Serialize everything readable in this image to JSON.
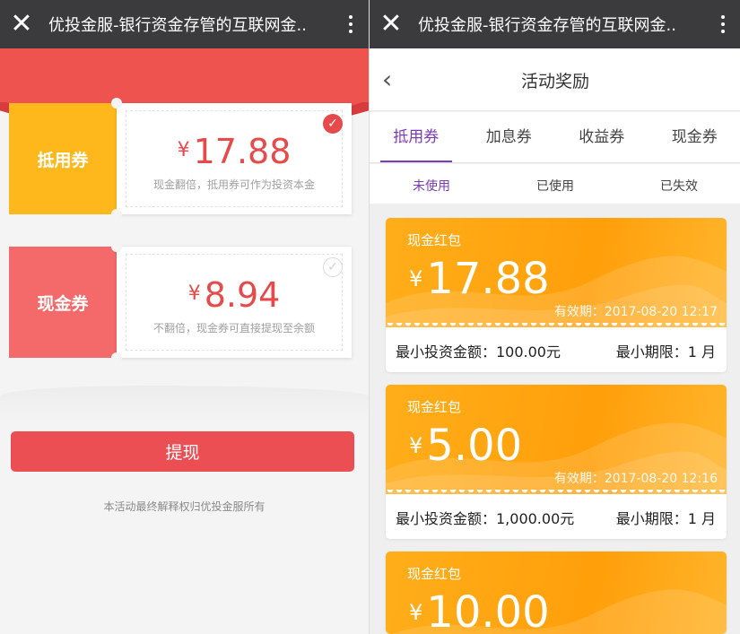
{
  "left": {
    "topbar": {
      "close": "✕",
      "title": "优投金服-银行资金存管的互联网金.."
    },
    "tickets": [
      {
        "type": "抵用券",
        "currency": "¥",
        "amount": "17.88",
        "desc": "现金翻倍，抵用券可作为投资本金",
        "checked": true,
        "stub_color": "#ffb81c"
      },
      {
        "type": "现金券",
        "currency": "¥",
        "amount": "8.94",
        "desc": "不翻倍，现金券可直接提现至余额",
        "checked": false,
        "stub_color": "#f46a6a"
      }
    ],
    "withdraw_label": "提现",
    "footer_note": "本活动最终解释权归优投金服所有"
  },
  "right": {
    "topbar": {
      "close": "✕",
      "title": "优投金服-银行资金存管的互联网金.."
    },
    "nav": {
      "back": "‹",
      "title": "活动奖励"
    },
    "tabs": [
      "抵用券",
      "加息券",
      "收益券",
      "现金券"
    ],
    "active_tab": 0,
    "subtabs": [
      "未使用",
      "已使用",
      "已失效"
    ],
    "active_subtab": 0,
    "cards": [
      {
        "title": "现金红包",
        "currency": "¥",
        "amount": "17.88",
        "expiry": "有效期：2017-08-20 12:17",
        "min_amount": "最小投资金额：100.00元",
        "min_term": "最小期限：1 月"
      },
      {
        "title": "现金红包",
        "currency": "¥",
        "amount": "5.00",
        "expiry": "有效期：2017-08-20 12:16",
        "min_amount": "最小投资金额：1,000.00元",
        "min_term": "最小期限：1 月"
      },
      {
        "title": "现金红包",
        "currency": "¥",
        "amount": "10.00",
        "expiry": "",
        "min_amount": "",
        "min_term": ""
      }
    ]
  },
  "colors": {
    "accent_red": "#ec4f53",
    "accent_purple": "#7a3bb5",
    "card_orange": "#ffa412"
  },
  "icons": {
    "close": "close-icon",
    "more": "more-vertical-icon",
    "back": "chevron-left-icon",
    "check": "check-circle-icon"
  }
}
